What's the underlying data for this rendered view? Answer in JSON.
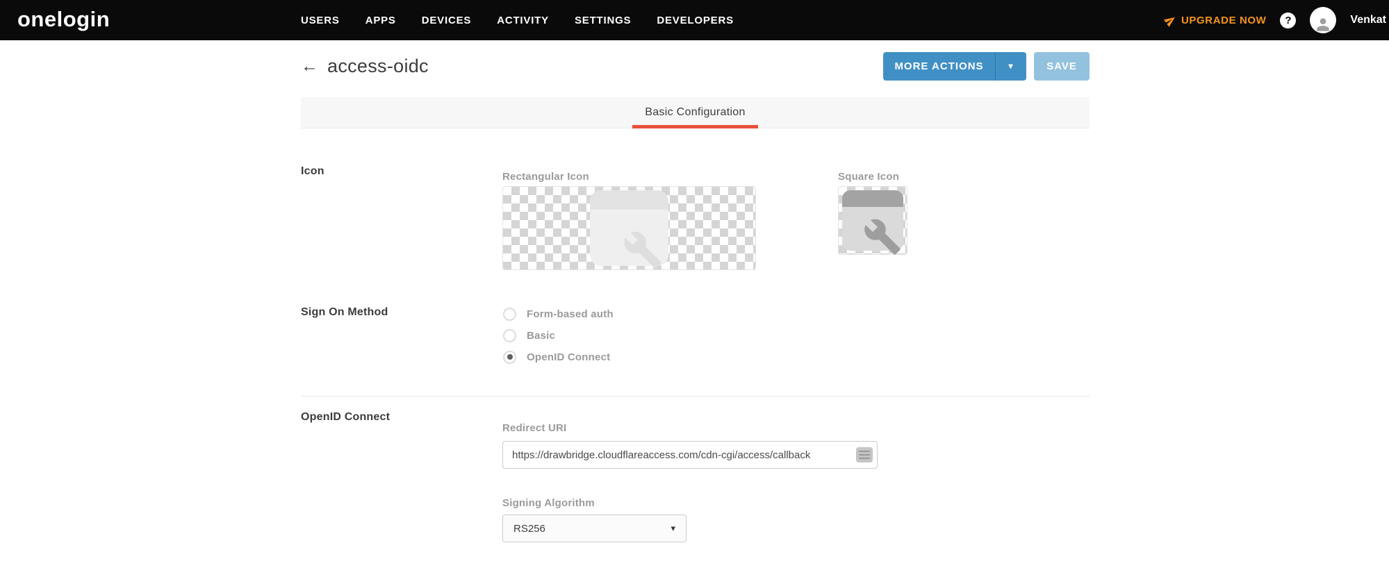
{
  "colors": {
    "nav_bg": "#0a0a0a",
    "upgrade_orange": "#F7941E",
    "primary_blue": "#4190C5",
    "save_blue_disabled": "#93C2DF",
    "tab_underline_red": "#E8513D",
    "text_dark": "#3c3c3c",
    "label_gray": "#9b9b9b"
  },
  "nav": {
    "logo": "onelogin",
    "items": [
      "USERS",
      "APPS",
      "DEVICES",
      "ACTIVITY",
      "SETTINGS",
      "DEVELOPERS"
    ],
    "upgrade_label": "UPGRADE NOW",
    "user_name": "Venkat"
  },
  "icons": {
    "back_arrow": "←",
    "help_glyph": "?",
    "caret_down": "▾"
  },
  "header": {
    "title": "access-oidc",
    "more_actions_label": "MORE ACTIONS",
    "save_label": "SAVE"
  },
  "tabs": {
    "active_tab": "Basic Configuration"
  },
  "sections": {
    "icon": {
      "label": "Icon",
      "rectangular_label": "Rectangular Icon",
      "square_label": "Square Icon"
    },
    "sign_on": {
      "label": "Sign On Method",
      "options": [
        {
          "label": "Form-based auth",
          "selected": false
        },
        {
          "label": "Basic",
          "selected": false
        },
        {
          "label": "OpenID Connect",
          "selected": true
        }
      ]
    },
    "oidc": {
      "label": "OpenID Connect",
      "redirect_uri_label": "Redirect URI",
      "redirect_uri_value": "https://drawbridge.cloudflareaccess.com/cdn-cgi/access/callback",
      "signing_algorithm_label": "Signing Algorithm",
      "signing_algorithm_value": "RS256"
    }
  }
}
